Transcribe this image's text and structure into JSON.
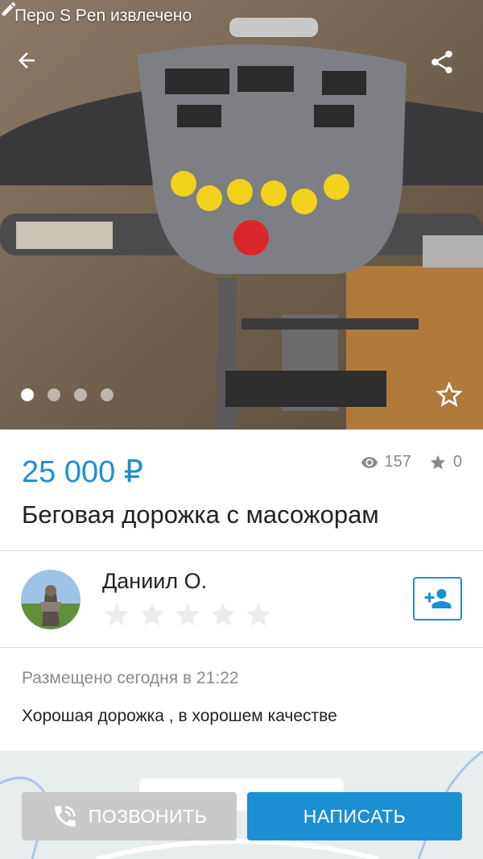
{
  "status_bar": {
    "notification": "Перо S Pen извлечено",
    "icon": "pen-icon"
  },
  "gallery": {
    "image_count": 4,
    "active_index": 0
  },
  "listing": {
    "price": "25 000 ₽",
    "views": "157",
    "favorites": "0",
    "title": "Беговая дорожка с масожорам"
  },
  "seller": {
    "name": "Даниил О.",
    "rating": 0,
    "rating_max": 5
  },
  "details": {
    "posted": "Размещено сегодня в 21:22",
    "description": "Хорошая дорожка , в хорошем качестве"
  },
  "actions": {
    "call_label": "ПОЗВОНИТЬ",
    "write_label": "НАПИСАТЬ"
  },
  "colors": {
    "accent": "#1c8fd3",
    "call_button": "#c9c9c9",
    "muted_text": "#8a8a8a"
  }
}
